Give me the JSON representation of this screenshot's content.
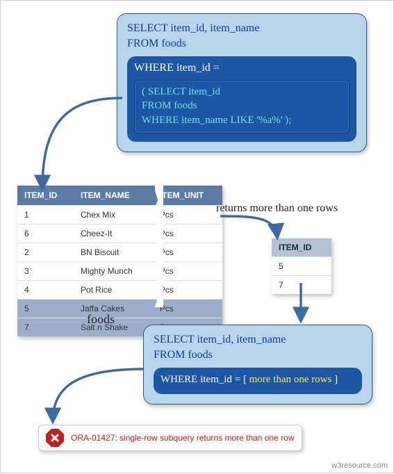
{
  "query1": {
    "line1": "SELECT item_id, item_name",
    "line2": "FROM foods",
    "where": "WHERE item_id =",
    "sub1": "( SELECT item_id",
    "sub2": "FROM foods",
    "sub3": "WHERE item_name LIKE '%a%' );"
  },
  "foods": {
    "label": "foods",
    "headers": {
      "c1": "ITEM_ID",
      "c2": "ITEM_NAME",
      "c3": "ITEM_UNIT"
    },
    "rows": [
      {
        "id": "1",
        "name": "Chex Mix",
        "unit": "Pcs",
        "hl": false
      },
      {
        "id": "6",
        "name": "Cheez-It",
        "unit": "Pcs",
        "hl": false
      },
      {
        "id": "2",
        "name": "BN Biscuit",
        "unit": "Pcs",
        "hl": false
      },
      {
        "id": "3",
        "name": "Mighty Munch",
        "unit": "Pcs",
        "hl": false
      },
      {
        "id": "4",
        "name": "Pot Rice",
        "unit": "Pcs",
        "hl": false
      },
      {
        "id": "5",
        "name": "Jaffa Cakes",
        "unit": "Pcs",
        "hl": true
      },
      {
        "id": "7",
        "name": "Salt n Shake",
        "unit": "Pcs",
        "hl": true
      }
    ]
  },
  "returns_label": "returns more than one rows",
  "itemid": {
    "header": "ITEM_ID",
    "rows": [
      "5",
      "7"
    ]
  },
  "query2": {
    "line1": "SELECT item_id, item_name",
    "line2": "FROM foods",
    "where_prefix": "WHERE item_id = [ ",
    "where_highlight": "more than one rows",
    "where_suffix": " ]"
  },
  "error": {
    "text": "ORA-01427: single-row subquery returns more than one row"
  },
  "watermark": "w3resource.com"
}
